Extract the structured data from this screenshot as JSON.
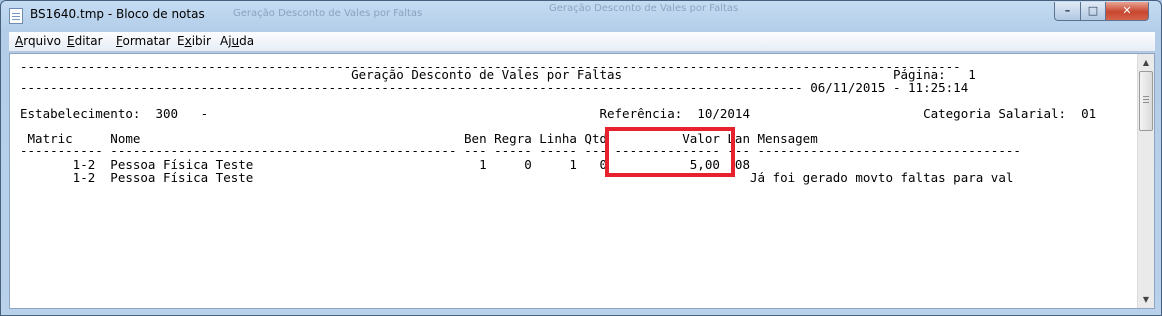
{
  "window": {
    "title": "BS1640.tmp - Bloco de notas",
    "ghost_doc": "Geração Desconto de Vales por Faltas",
    "ghost_app": "Geração Desconto de Vales por Faltas"
  },
  "caption_buttons": {
    "minimize": "–",
    "maximize": "□",
    "close": "✕"
  },
  "menu": [
    {
      "label": "Arquivo",
      "accel": "A"
    },
    {
      "label": "Editar",
      "accel": "E"
    },
    {
      "label": "Formatar",
      "accel": "F"
    },
    {
      "label": "Exibir",
      "accel": "x"
    },
    {
      "label": "Ajuda",
      "accel": "u"
    }
  ],
  "report": {
    "dash_top": "-----------------------------------------------------------------------------------------------------------------------------",
    "title_line": "                                            Geração Desconto de Vales por Faltas                                    Página:   1",
    "date_line": "-------------------------------------------------------------------------------------------------------- 06/11/2015 - 11:25:14",
    "blank": "",
    "establishment_line": "Estabelecimento:  300   -                                                    Referência:  10/2014                       Categoria Salarial:  01",
    "blank2": "",
    "header_line": " Matric     Nome                                           Ben Regra Linha Qtd          Valor Lan Mensagem",
    "dash_header": "----------- ---------------------------------------------- --- ----- ----- --- -------------- --- -----------------------------------",
    "row1": "       1-2  Pessoa Física Teste                              1     0     1   0           5,00  08",
    "row2": "       1-2  Pessoa Física Teste                                                                  Já foi gerado movto faltas para val"
  },
  "highlight": {
    "column": "Valor",
    "value": "5,00",
    "color": "#e8212f"
  },
  "scrollbar": {
    "up_icon": "▲",
    "down_icon": "▼"
  }
}
